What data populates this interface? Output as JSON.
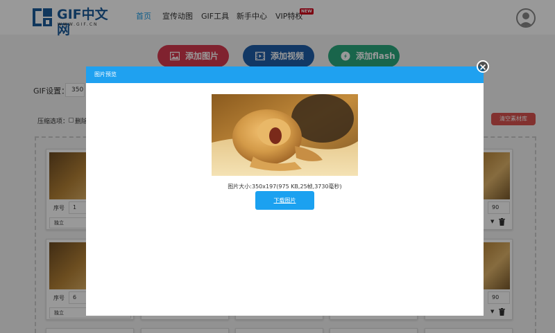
{
  "logo": {
    "text": "GIF中文网",
    "subtext": "WWW.GIF.CN"
  },
  "nav": [
    {
      "label": "首页",
      "active": true
    },
    {
      "label": "宣传动图",
      "active": false
    },
    {
      "label": "GIF工具",
      "active": false
    },
    {
      "label": "新手中心",
      "active": false
    },
    {
      "label": "VIP特权",
      "active": false
    }
  ],
  "nav_badge": "NEW",
  "actions": {
    "add_image": "添加图片",
    "add_video": "添加视频",
    "add_flash": "添加flash"
  },
  "gif_settings": {
    "label": "GIF设置：",
    "value": "350"
  },
  "compress": {
    "label": "压缩选项：",
    "option": "删除"
  },
  "clear_button": "清空素材库",
  "cards": {
    "seq_label": "序号",
    "row1": {
      "seq": "1",
      "mode": "独立",
      "right_value": "90"
    },
    "row2": {
      "seq": "6",
      "mode": "独立",
      "right_value": "90"
    }
  },
  "modal": {
    "title": "图片预览",
    "info": "图片大小:350x197(975 KB,25帧,3730毫秒)",
    "download": "下载图片"
  },
  "colors": {
    "accent": "#1fa1f0",
    "add_image": "#d63a4f",
    "add_video": "#1f5ea8",
    "add_flash": "#2aa87d",
    "clear": "#d9534f"
  }
}
